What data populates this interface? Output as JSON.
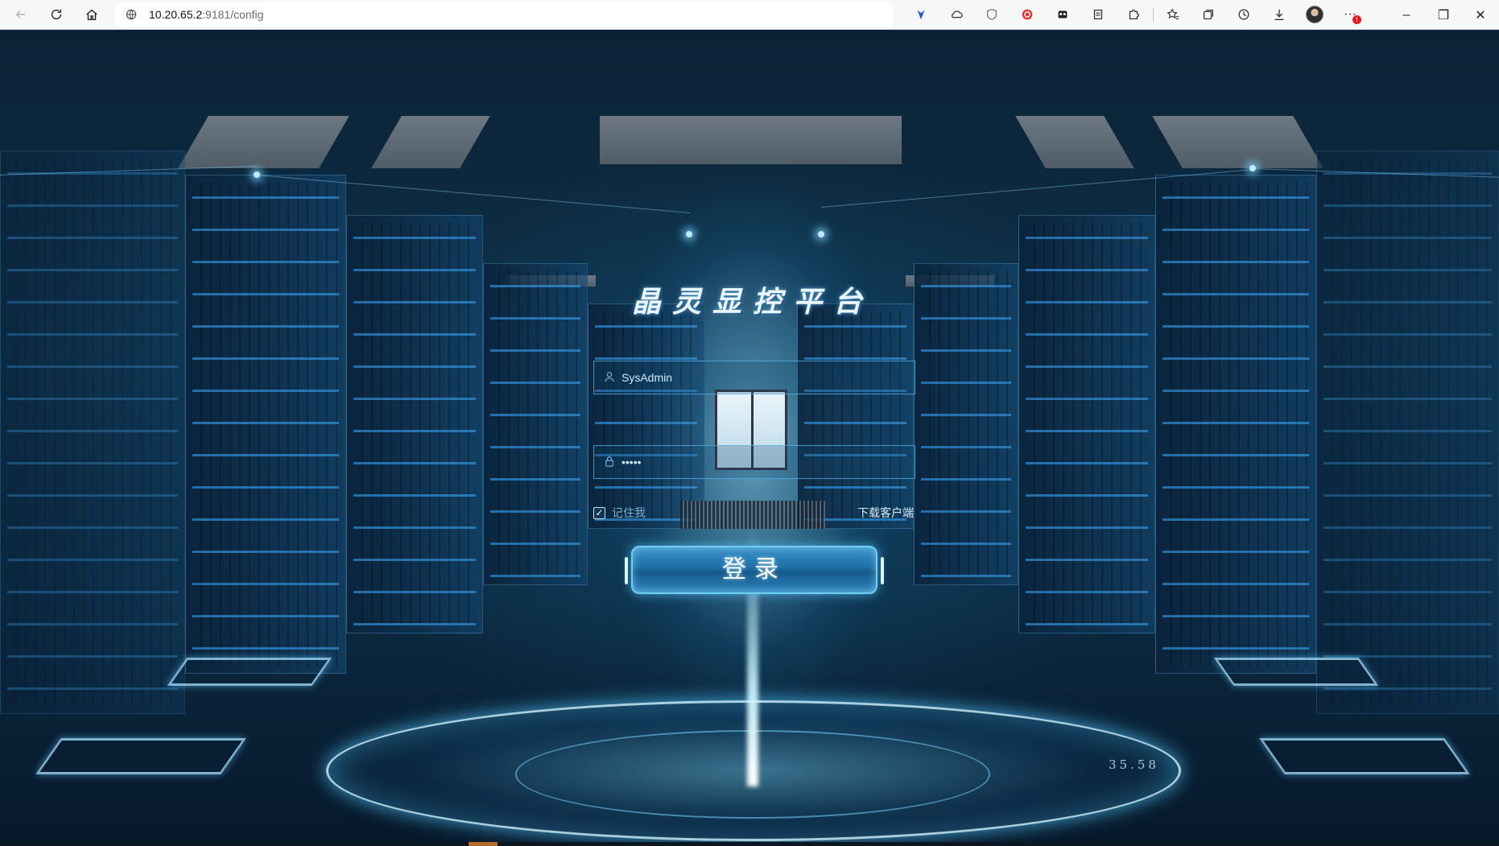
{
  "browser": {
    "url_host": "10.20.65.2",
    "url_path": ":9181/config",
    "back_icon": "arrow-left-icon",
    "refresh_icon": "refresh-icon",
    "home_icon": "home-icon",
    "toolbar": [
      "location-pin-icon",
      "cloud-icon",
      "shield-icon",
      "adblock-icon",
      "extension-panel-icon",
      "reading-icon",
      "puzzle-icon",
      "favorites-icon",
      "collections-icon",
      "history-icon",
      "download-icon",
      "profile-avatar",
      "more-icon"
    ],
    "more_badge": "!",
    "window_controls": {
      "minimize": "–",
      "restore": "❐",
      "close": "✕"
    }
  },
  "login": {
    "title": "晶灵显控平台",
    "username_value": "SysAdmin",
    "username_placeholder": "SysAdmin",
    "password_value": "•••••",
    "remember_checked": true,
    "remember_label": "记住我",
    "download_label": "下载客户端",
    "submit_label": "登录"
  },
  "scene": {
    "counter_text": "35.58"
  },
  "colors": {
    "accent": "#2d86bf",
    "glow": "#6ecff5",
    "background": "#0c2a42"
  }
}
